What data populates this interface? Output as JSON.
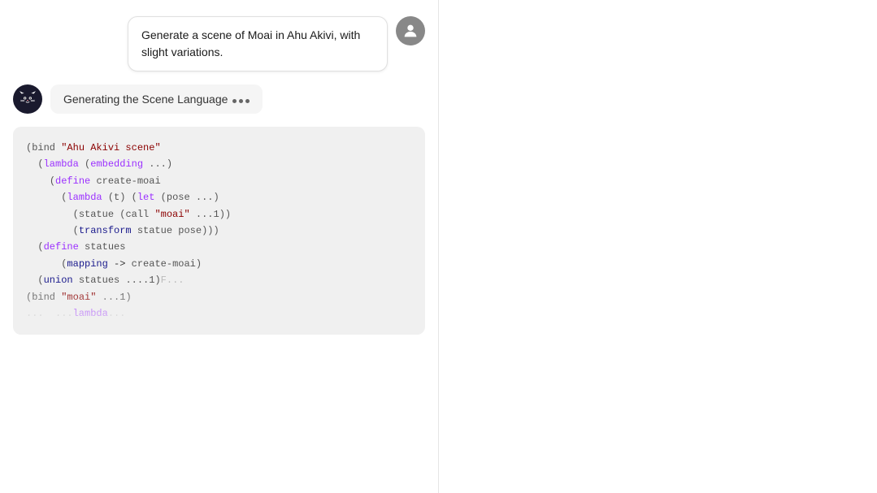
{
  "chat": {
    "user_message": "Generate a scene of Moai in Ahu Akivi, with slight variations.",
    "assistant_generating_label": "Generating the Scene Language",
    "dots_count": 3
  },
  "code": {
    "lines": [
      {
        "id": 1,
        "text": "(bind \"Ahu Akivi scene\""
      },
      {
        "id": 2,
        "text": "  (lambda (embedding ...)"
      },
      {
        "id": 3,
        "text": "    (define create-moai"
      },
      {
        "id": 4,
        "text": "      (lambda (t) (let (pose ...)"
      },
      {
        "id": 5,
        "text": "        (statue (call \"moai\" ...1))"
      },
      {
        "id": 6,
        "text": "        (transform statue pose)))"
      },
      {
        "id": 7,
        "text": "  (define statues"
      },
      {
        "id": 8,
        "text": "      (mapping -> create-moai)"
      },
      {
        "id": 9,
        "text": "  (union statues ....1)F..."
      },
      {
        "id": 10,
        "text": "(bind \"moai\" ...1)"
      },
      {
        "id": 11,
        "text": "...  ...lambda..."
      }
    ]
  },
  "icons": {
    "user_icon": "👤",
    "assistant_icon": "🤖"
  }
}
